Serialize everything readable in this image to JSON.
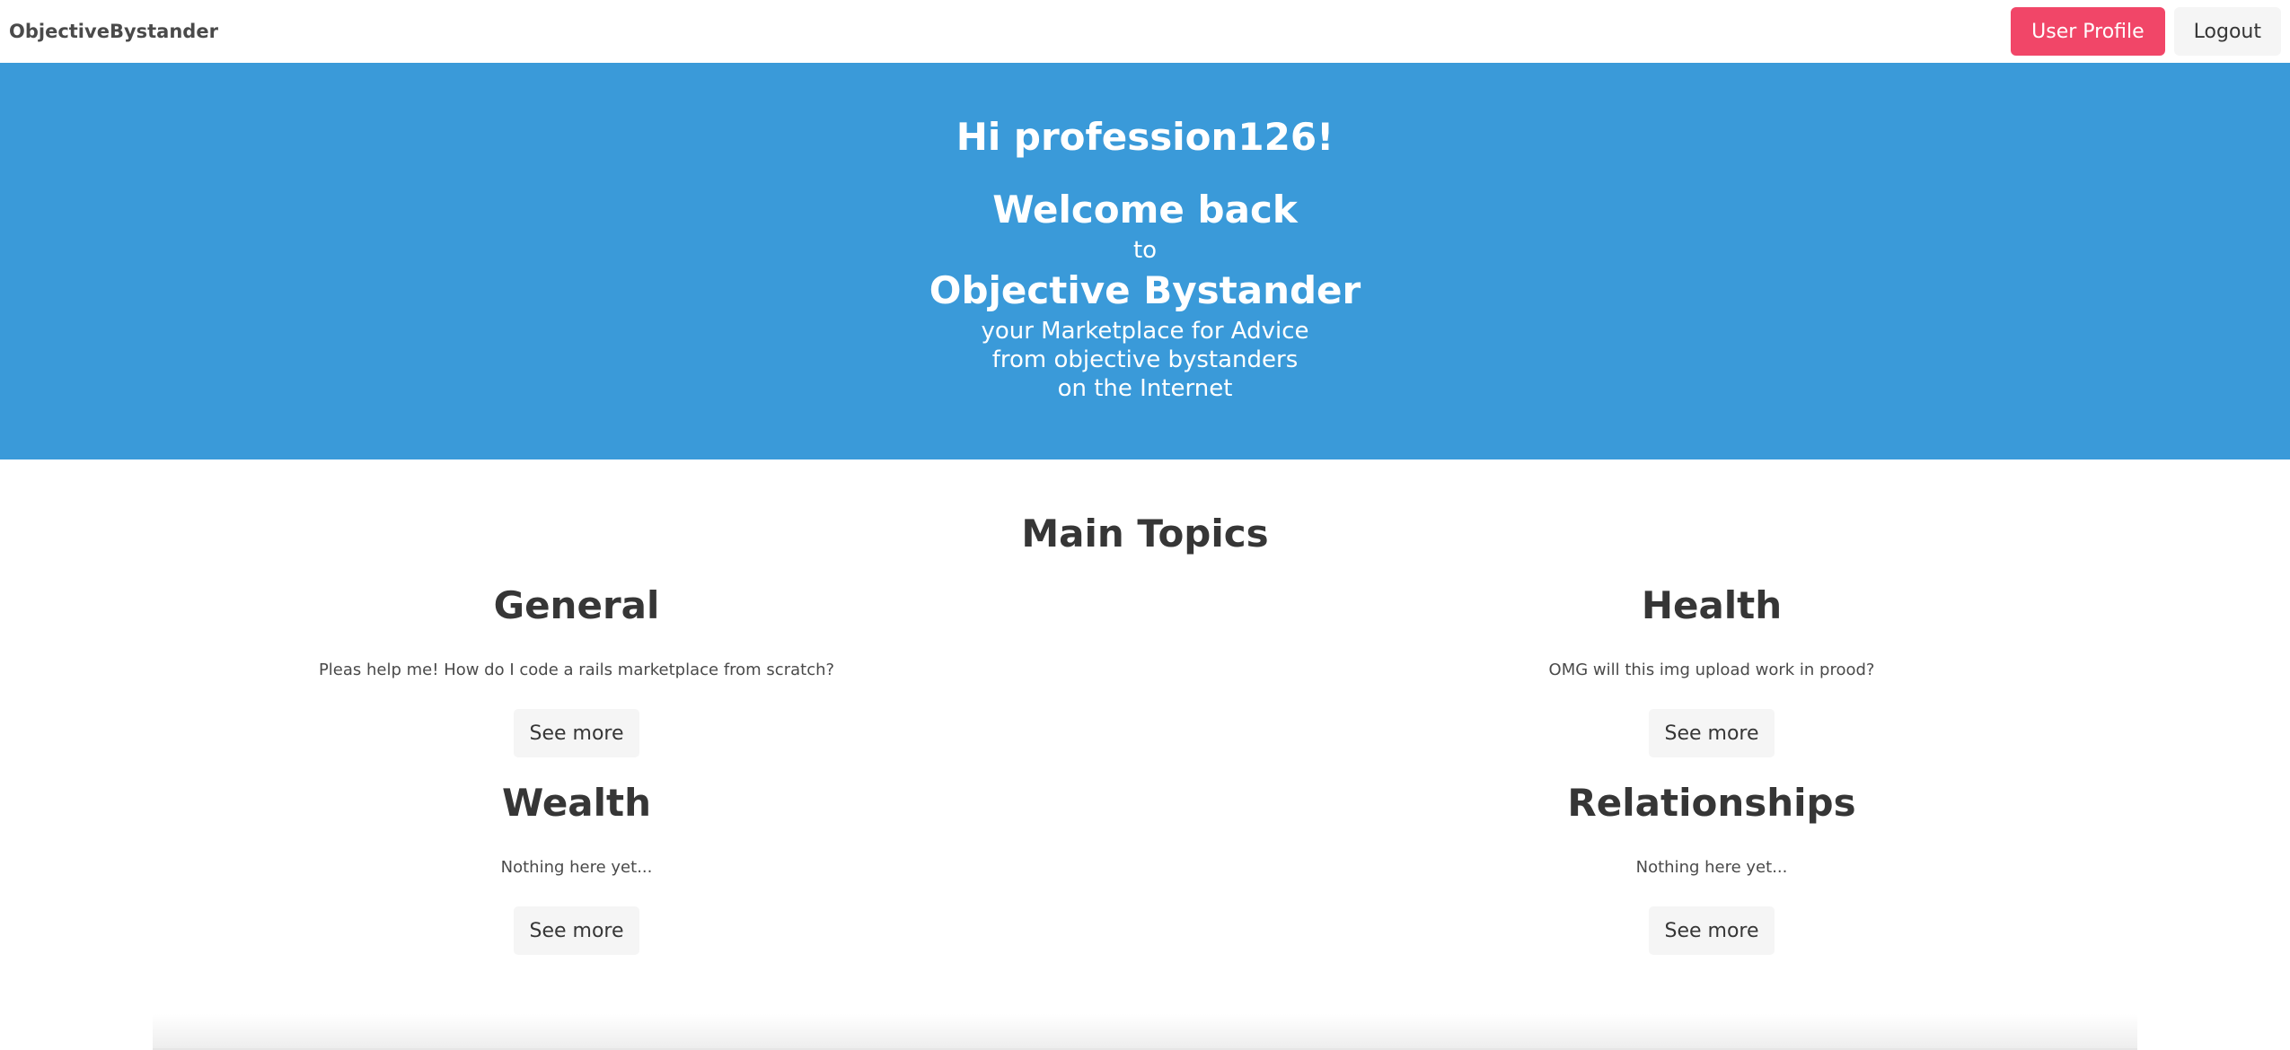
{
  "navbar": {
    "brand": "ObjectiveBystander",
    "user_profile_label": "User Profile",
    "logout_label": "Logout"
  },
  "hero": {
    "greeting": "Hi profession126!",
    "welcome": "Welcome back",
    "to": "to",
    "app_name": "Objective Bystander",
    "tagline_lines": [
      "your Marketplace for Advice",
      "from objective bystanders",
      "on the Internet"
    ]
  },
  "main": {
    "section_title": "Main Topics",
    "topics": [
      {
        "title": "General",
        "description": "Pleas help me! How do I code a rails marketplace from scratch?",
        "button": "See more"
      },
      {
        "title": "Health",
        "description": "OMG will this img upload work in prood?",
        "button": "See more"
      },
      {
        "title": "Wealth",
        "description": "Nothing here yet...",
        "button": "See more"
      },
      {
        "title": "Relationships",
        "description": "Nothing here yet...",
        "button": "See more"
      }
    ]
  },
  "colors": {
    "hero_background": "#3a9ad9",
    "primary_button": "#f14668",
    "light_button": "#f5f5f5"
  }
}
